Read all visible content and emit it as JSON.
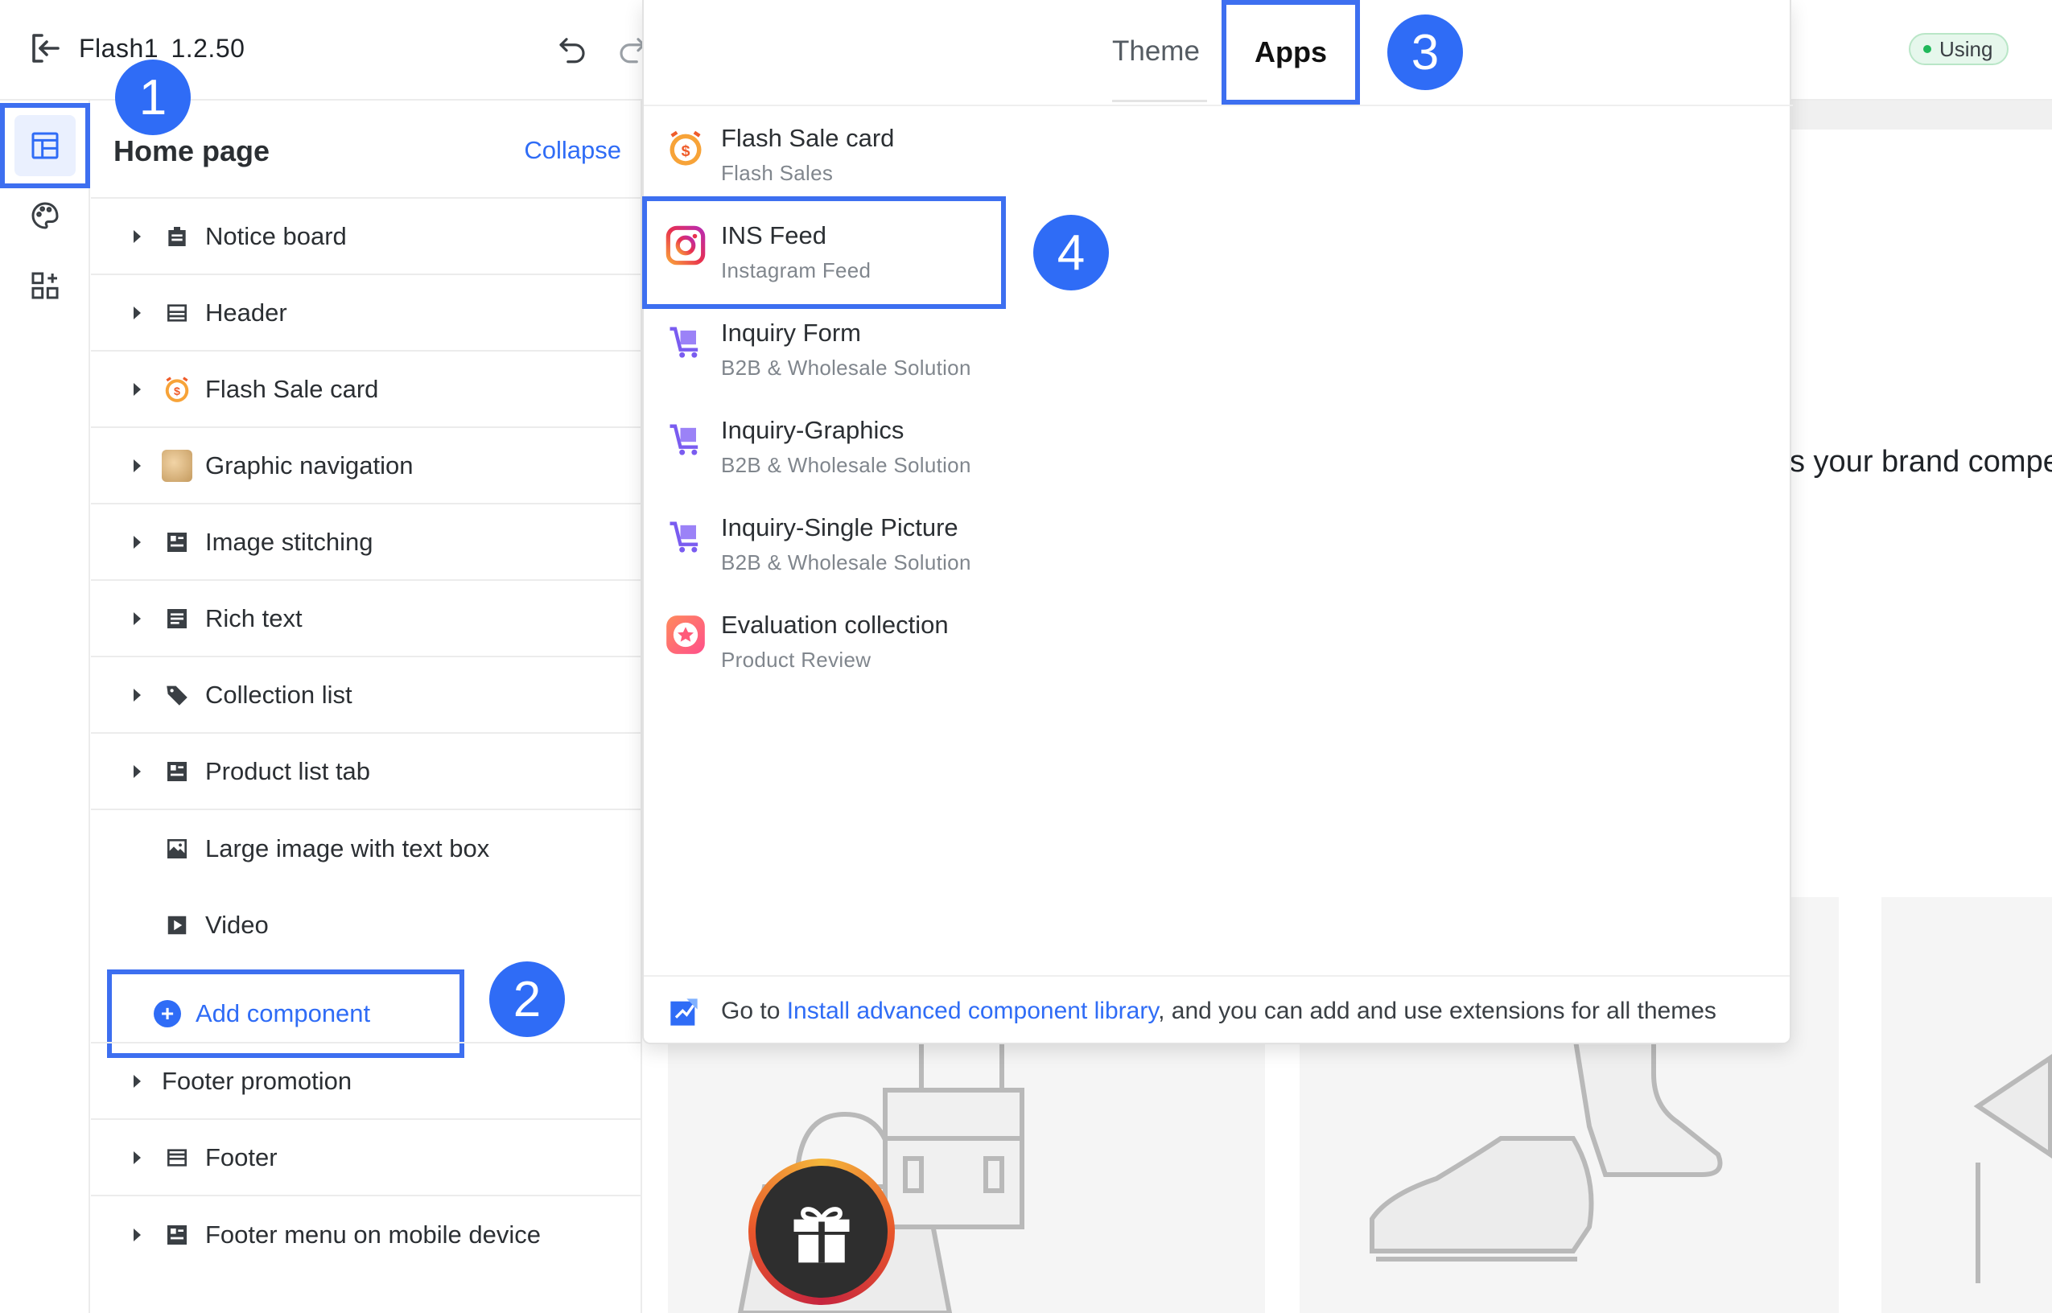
{
  "topbar": {
    "app_title": "Flash1",
    "version": "1.2.50",
    "status_badge": "Using",
    "icons": [
      "exit-icon",
      "undo-icon",
      "redo-icon"
    ]
  },
  "rail": {
    "items": [
      {
        "name": "layout",
        "icon": "layout-icon",
        "active": true
      },
      {
        "name": "theme",
        "icon": "palette-icon",
        "active": false
      },
      {
        "name": "apps",
        "icon": "apps-add-icon",
        "active": false
      }
    ]
  },
  "panel": {
    "title": "Home page",
    "collapse_label": "Collapse",
    "components": [
      {
        "label": "Notice board",
        "icon": "notice-board-icon",
        "expandable": true
      },
      {
        "label": "Header",
        "icon": "header-icon",
        "expandable": true
      },
      {
        "label": "Flash Sale card",
        "icon": "flash-sale-icon",
        "expandable": true
      },
      {
        "label": "Graphic navigation",
        "icon": "graphic-navigation-icon",
        "expandable": true
      },
      {
        "label": "Image stitching",
        "icon": "image-stitching-icon",
        "expandable": true
      },
      {
        "label": "Rich text",
        "icon": "rich-text-icon",
        "expandable": true
      },
      {
        "label": "Collection list",
        "icon": "collection-tag-icon",
        "expandable": true
      },
      {
        "label": "Product list tab",
        "icon": "product-list-icon",
        "expandable": true
      },
      {
        "label": "Large image with text box",
        "icon": "image-text-icon",
        "expandable": false
      },
      {
        "label": "Video",
        "icon": "video-icon",
        "expandable": false
      }
    ],
    "add_component_label": "Add component",
    "footer_components": [
      {
        "label": "Footer promotion",
        "icon": "",
        "expandable": true
      },
      {
        "label": "Footer",
        "icon": "footer-icon",
        "expandable": true
      },
      {
        "label": "Footer menu on mobile device",
        "icon": "footer-menu-icon",
        "expandable": true
      }
    ]
  },
  "dropdown": {
    "tabs": [
      {
        "label": "Theme",
        "active": false
      },
      {
        "label": "Apps",
        "active": true
      }
    ],
    "apps": [
      {
        "name": "Flash Sale card",
        "source": "Flash Sales",
        "icon": "flash-sale-icon"
      },
      {
        "name": "INS Feed",
        "source": "Instagram Feed",
        "icon": "instagram-icon"
      },
      {
        "name": "Inquiry Form",
        "source": "B2B & Wholesale Solution",
        "icon": "cart-icon"
      },
      {
        "name": "Inquiry-Graphics",
        "source": "B2B & Wholesale Solution",
        "icon": "cart-icon"
      },
      {
        "name": "Inquiry-Single Picture",
        "source": "B2B & Wholesale Solution",
        "icon": "cart-icon"
      },
      {
        "name": "Evaluation collection",
        "source": "Product Review",
        "icon": "star-review-icon"
      }
    ],
    "footer": {
      "prefix": "Go to ",
      "link": "Install advanced component library",
      "suffix": ", and you can add and use extensions for all themes"
    }
  },
  "preview": {
    "caption": "s your brand compe"
  },
  "markers": [
    "1",
    "2",
    "3",
    "4"
  ],
  "colors": {
    "accent": "#2f6cf6",
    "highlight_border": "#3d6ff0",
    "status_green": "#20b85a"
  }
}
